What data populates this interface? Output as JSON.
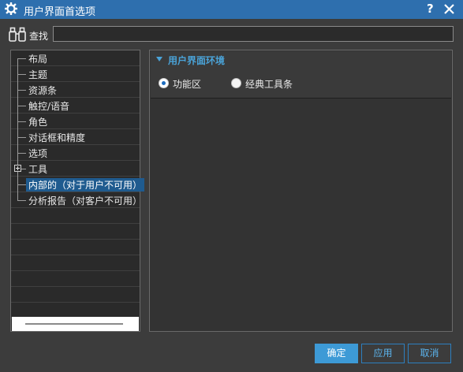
{
  "window": {
    "title": "用户界面首选项",
    "help_label": "?",
    "icons": {
      "app": "gear-icon",
      "close": "close-icon"
    }
  },
  "search": {
    "label": "查找",
    "value": "",
    "icon": "binoculars-icon"
  },
  "tree": {
    "items": [
      {
        "label": "布局",
        "expandable": false,
        "selected": false
      },
      {
        "label": "主题",
        "expandable": false,
        "selected": false
      },
      {
        "label": "资源条",
        "expandable": false,
        "selected": false
      },
      {
        "label": "触控/语音",
        "expandable": false,
        "selected": false
      },
      {
        "label": "角色",
        "expandable": false,
        "selected": false
      },
      {
        "label": "对话框和精度",
        "expandable": false,
        "selected": false
      },
      {
        "label": "选项",
        "expandable": false,
        "selected": false
      },
      {
        "label": "工具",
        "expandable": true,
        "selected": false
      },
      {
        "label": "内部的（对于用户不可用）",
        "expandable": false,
        "selected": true
      },
      {
        "label": "分析报告（对客户不可用）",
        "expandable": false,
        "selected": false
      }
    ]
  },
  "group": {
    "title": "用户界面环境",
    "options": [
      {
        "label": "功能区",
        "checked": true
      },
      {
        "label": "经典工具条",
        "checked": false
      }
    ]
  },
  "buttons": {
    "ok": "确定",
    "apply": "应用",
    "cancel": "取消"
  },
  "colors": {
    "titlebar": "#2e6fae",
    "accent": "#4aa3d8",
    "selection": "#1f5b8f",
    "primary_button": "#3d9ad6"
  }
}
